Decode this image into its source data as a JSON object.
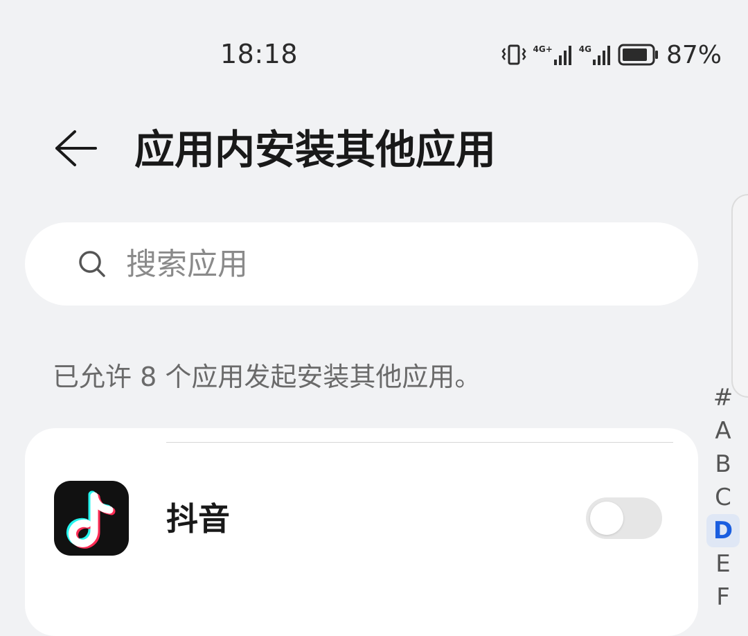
{
  "status_bar": {
    "time": "18:18",
    "network_1": "4G+",
    "network_2": "4G",
    "battery_percent": "87%",
    "battery_level": 0.87
  },
  "header": {
    "title": "应用内安装其他应用"
  },
  "search": {
    "placeholder": "搜索应用",
    "value": ""
  },
  "info": {
    "text": "已允许 8 个应用发起安装其他应用。"
  },
  "apps": [
    {
      "name": "抖音",
      "icon": "douyin-icon",
      "enabled": false
    }
  ],
  "alpha_index": {
    "letters": [
      "#",
      "A",
      "B",
      "C",
      "D",
      "E",
      "F"
    ],
    "active": "D"
  },
  "colors": {
    "background": "#f1f2f4",
    "card": "#ffffff",
    "accent": "#1a5ee0",
    "toggle_off": "#e6e6e6"
  }
}
